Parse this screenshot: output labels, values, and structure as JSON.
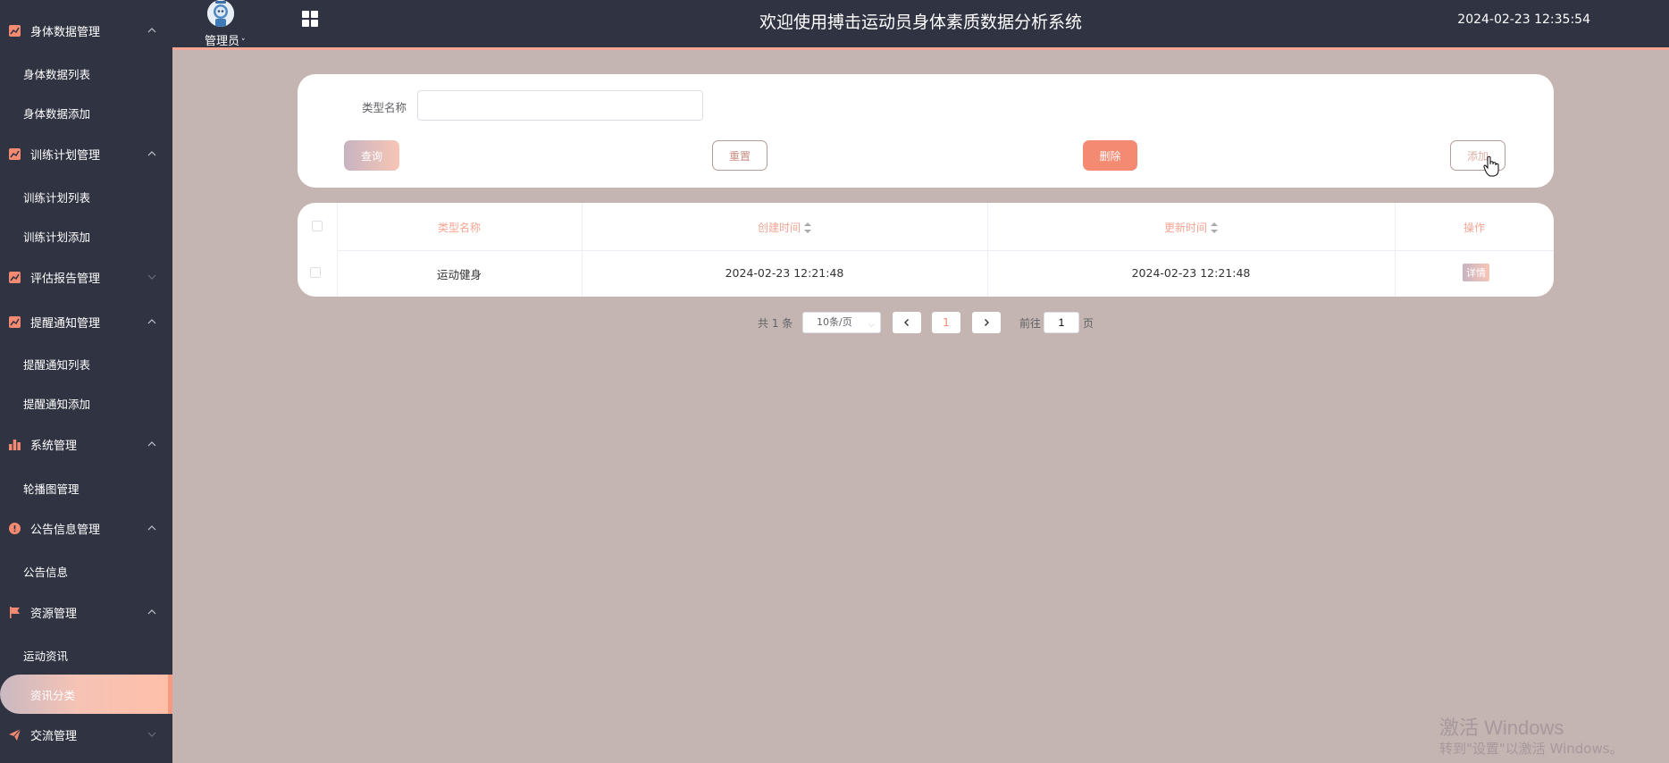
{
  "header": {
    "title": "欢迎使用搏击运动员身体素质数据分析系统",
    "admin_label": "管理员",
    "datetime": "2024-02-23 12:35:54"
  },
  "sidebar": {
    "groups": [
      {
        "label": "身体数据管理",
        "icon": "chart-icon",
        "expanded": true,
        "items": [
          "身体数据列表",
          "身体数据添加"
        ]
      },
      {
        "label": "训练计划管理",
        "icon": "chart-icon",
        "expanded": true,
        "items": [
          "训练计划列表",
          "训练计划添加"
        ]
      },
      {
        "label": "评估报告管理",
        "icon": "chart-icon",
        "expanded": false,
        "items": []
      },
      {
        "label": "提醒通知管理",
        "icon": "chart-icon",
        "expanded": true,
        "items": [
          "提醒通知列表",
          "提醒通知添加"
        ]
      },
      {
        "label": "系统管理",
        "icon": "bar-chart-icon",
        "expanded": true,
        "items": [
          "轮播图管理"
        ]
      },
      {
        "label": "公告信息管理",
        "icon": "info-icon",
        "expanded": true,
        "items": [
          "公告信息"
        ]
      },
      {
        "label": "资源管理",
        "icon": "flag-icon",
        "expanded": true,
        "items": [
          "运动资讯",
          "资讯分类"
        ]
      },
      {
        "label": "交流管理",
        "icon": "paper-plane-icon",
        "expanded": false,
        "items": []
      }
    ],
    "active_item": "资讯分类"
  },
  "search": {
    "label": "类型名称",
    "value": "",
    "query_label": "查询",
    "reset_label": "重置",
    "delete_label": "删除",
    "add_label": "添加"
  },
  "table": {
    "columns": [
      "类型名称",
      "创建时间",
      "更新时间",
      "操作"
    ],
    "rows": [
      {
        "name": "运动健身",
        "created": "2024-02-23 12:21:48",
        "updated": "2024-02-23 12:21:48",
        "action": "详情"
      }
    ]
  },
  "pagination": {
    "total_text": "共 1 条",
    "page_size": "10条/页",
    "current_page": "1",
    "goto_label": "前往",
    "goto_value": "1",
    "page_suffix": "页"
  },
  "watermark": {
    "line1": "激活 Windows",
    "line2": "转到\"设置\"以激活 Windows。"
  },
  "colors": {
    "sidebar_bg": "#303341",
    "page_bg": "#c4b5b2",
    "accent": "#f58a72",
    "accent_light": "#f4a593"
  }
}
